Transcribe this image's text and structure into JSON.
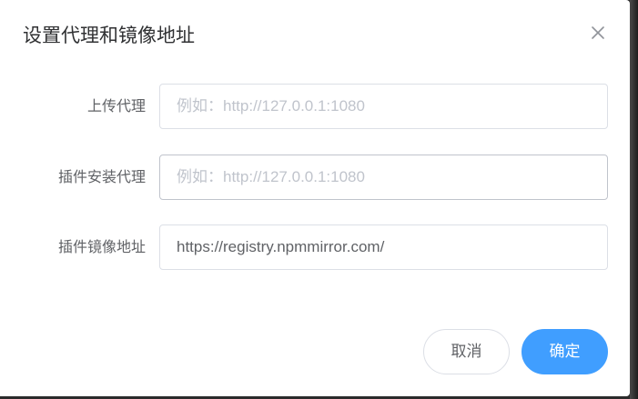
{
  "dialog": {
    "title": "设置代理和镜像地址",
    "close_icon": "close-icon"
  },
  "form": {
    "fields": [
      {
        "label": "上传代理",
        "value": "",
        "placeholder": "例如：http://127.0.0.1:1080"
      },
      {
        "label": "插件安装代理",
        "value": "",
        "placeholder": "例如：http://127.0.0.1:1080"
      },
      {
        "label": "插件镜像地址",
        "value": "https://registry.npmmirror.com/",
        "placeholder": ""
      }
    ]
  },
  "footer": {
    "cancel_label": "取消",
    "confirm_label": "确定"
  },
  "colors": {
    "primary": "#409eff",
    "border": "#dcdfe6",
    "text": "#606266",
    "placeholder": "#c0c4cc"
  }
}
